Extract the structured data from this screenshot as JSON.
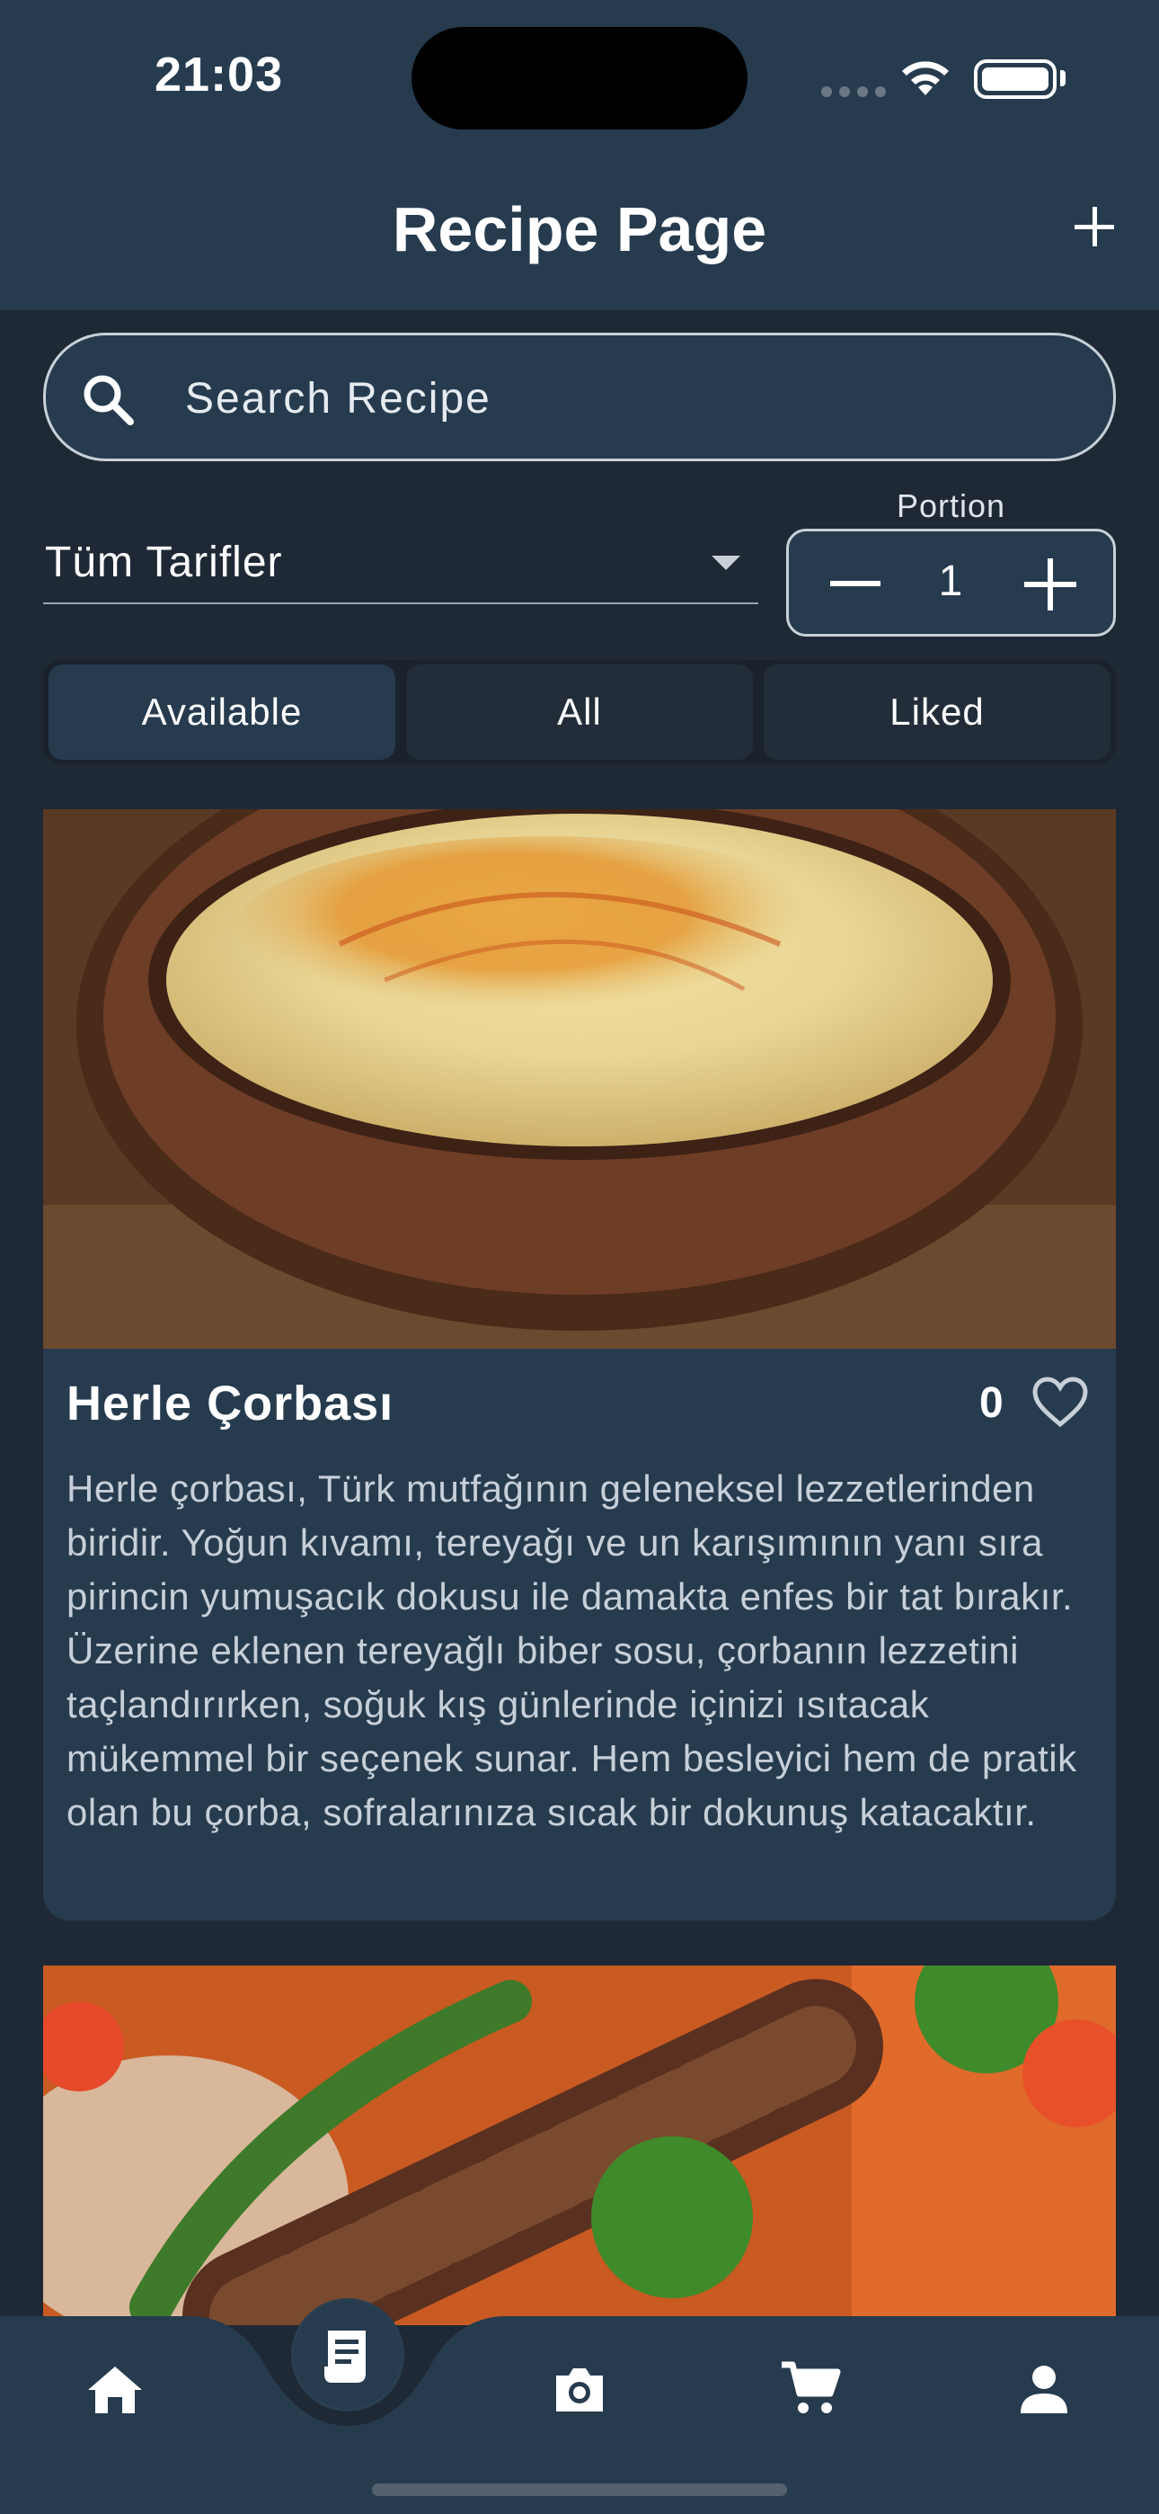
{
  "status_bar": {
    "time": "21:03"
  },
  "header": {
    "title": "Recipe Page",
    "add_icon": "plus-icon"
  },
  "search": {
    "placeholder": "Search Recipe",
    "value": "",
    "icon": "search-icon"
  },
  "filters": {
    "category": "Tüm Tarifler",
    "portion_label": "Portion",
    "portion_value": "1"
  },
  "segments": [
    {
      "label": "Available",
      "active": true
    },
    {
      "label": "All",
      "active": false
    },
    {
      "label": "Liked",
      "active": false
    }
  ],
  "recipes": [
    {
      "title": "Herle Çorbası",
      "likes": "0",
      "description": "Herle çorbası, Türk mutfağının geleneksel lezzetlerinden biridir. Yoğun kıvamı, tereyağı ve un karışımının yanı sıra pirincin yumuşacık dokusu ile damakta enfes bir tat bırakır. Üzerine eklenen tereyağlı biber sosu, çorbanın lezzetini taçlandırırken, soğuk kış günlerinde içinizi ısıtacak mükemmel bir seçenek sunar. Hem besleyici hem de pratik olan bu çorba, sofralarınıza sıcak bir dokunuş katacaktır."
    }
  ],
  "bottom_nav": {
    "items": [
      "home-icon",
      "recipe-icon",
      "camera-icon",
      "cart-icon",
      "profile-icon"
    ],
    "active": "recipe-icon"
  },
  "colors": {
    "header_bg": "#263b4e",
    "page_bg": "#1f2935",
    "card_bg": "#263b4e",
    "text": "#ffffff",
    "muted_text": "#c7cfd8"
  }
}
